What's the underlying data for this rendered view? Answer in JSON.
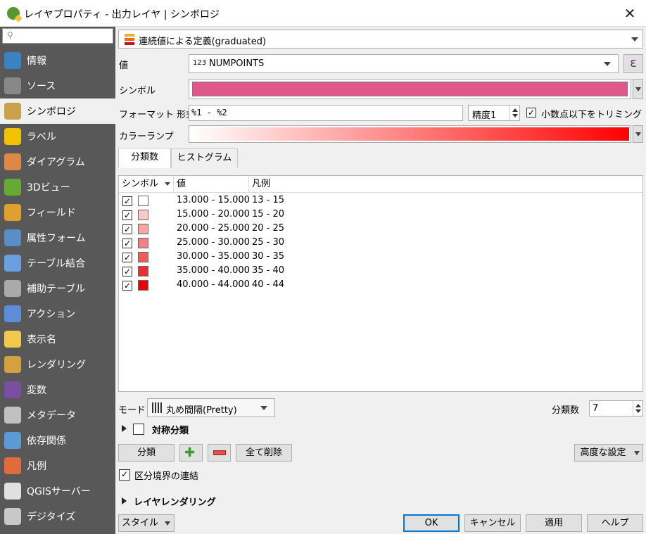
{
  "window": {
    "title": "レイヤプロパティ - 出力レイヤ | シンボロジ"
  },
  "sidebar": {
    "search_placeholder": "",
    "items": [
      {
        "label": "情報",
        "icon": "info-icon"
      },
      {
        "label": "ソース",
        "icon": "source-wrench-icon"
      },
      {
        "label": "シンボロジ",
        "icon": "symbology-brush-icon"
      },
      {
        "label": "ラベル",
        "icon": "label-abc-icon"
      },
      {
        "label": "ダイアグラム",
        "icon": "diagram-icon"
      },
      {
        "label": "3Dビュー",
        "icon": "cube-3d-icon"
      },
      {
        "label": "フィールド",
        "icon": "fields-icon"
      },
      {
        "label": "属性フォーム",
        "icon": "form-icon"
      },
      {
        "label": "テーブル結合",
        "icon": "join-icon"
      },
      {
        "label": "補助テーブル",
        "icon": "auxiliary-storage-icon"
      },
      {
        "label": "アクション",
        "icon": "action-gear-icon"
      },
      {
        "label": "表示名",
        "icon": "display-speech-icon"
      },
      {
        "label": "レンダリング",
        "icon": "rendering-brush-icon"
      },
      {
        "label": "変数",
        "icon": "variable-epsilon-icon"
      },
      {
        "label": "メタデータ",
        "icon": "metadata-icon"
      },
      {
        "label": "依存関係",
        "icon": "dependencies-icon"
      },
      {
        "label": "凡例",
        "icon": "legend-icon"
      },
      {
        "label": "QGISサーバー",
        "icon": "server-icon"
      },
      {
        "label": "デジタイズ",
        "icon": "digitize-icon"
      }
    ],
    "active_index": 2
  },
  "renderer": {
    "type_label": "連続値による定義(graduated)"
  },
  "value": {
    "label": "値",
    "prefix": "123",
    "field": "NUMPOINTS"
  },
  "symbol": {
    "label": "シンボル",
    "color": "#e0588a"
  },
  "format": {
    "label": "フォーマット 形式",
    "value": "%1 - %2",
    "precision": "精度1",
    "trim_label": "小数点以下をトリミング",
    "trim_checked": "✓"
  },
  "ramp": {
    "label": "カラーランプ"
  },
  "tabs": [
    {
      "label": "分類数"
    },
    {
      "label": "ヒストグラム"
    }
  ],
  "table": {
    "headers": {
      "symbol": "シンボル",
      "value": "値",
      "legend": "凡例"
    },
    "rows": [
      {
        "check": "✓",
        "color": "#ffffff",
        "value": "13.000 - 15.000",
        "legend": "13 - 15"
      },
      {
        "check": "✓",
        "color": "#fcc8c8",
        "value": "15.000 - 20.000",
        "legend": "15 - 20"
      },
      {
        "check": "✓",
        "color": "#fba4a4",
        "value": "20.000 - 25.000",
        "legend": "20 - 25"
      },
      {
        "check": "✓",
        "color": "#f88080",
        "value": "25.000 - 30.000",
        "legend": "25 - 30"
      },
      {
        "check": "✓",
        "color": "#f45a5a",
        "value": "30.000 - 35.000",
        "legend": "30 - 35"
      },
      {
        "check": "✓",
        "color": "#f02c2c",
        "value": "35.000 - 40.000",
        "legend": "35 - 40"
      },
      {
        "check": "✓",
        "color": "#ee0000",
        "value": "40.000 - 44.000",
        "legend": "40 - 44"
      }
    ]
  },
  "mode": {
    "label": "モード",
    "value": "丸め間隔(Pretty)",
    "classes_label": "分類数",
    "classes_value": "7"
  },
  "symmetric": {
    "label": "対称分類"
  },
  "actions": {
    "classify": "分類",
    "delete_all": "全て削除",
    "advanced": "高度な設定"
  },
  "link_boundaries": {
    "label": "区分境界の連結",
    "checked": "✓"
  },
  "layer_rendering": {
    "label": "レイヤレンダリング"
  },
  "footer": {
    "style": "スタイル",
    "ok": "OK",
    "cancel": "キャンセル",
    "apply": "適用",
    "help": "ヘルプ"
  }
}
